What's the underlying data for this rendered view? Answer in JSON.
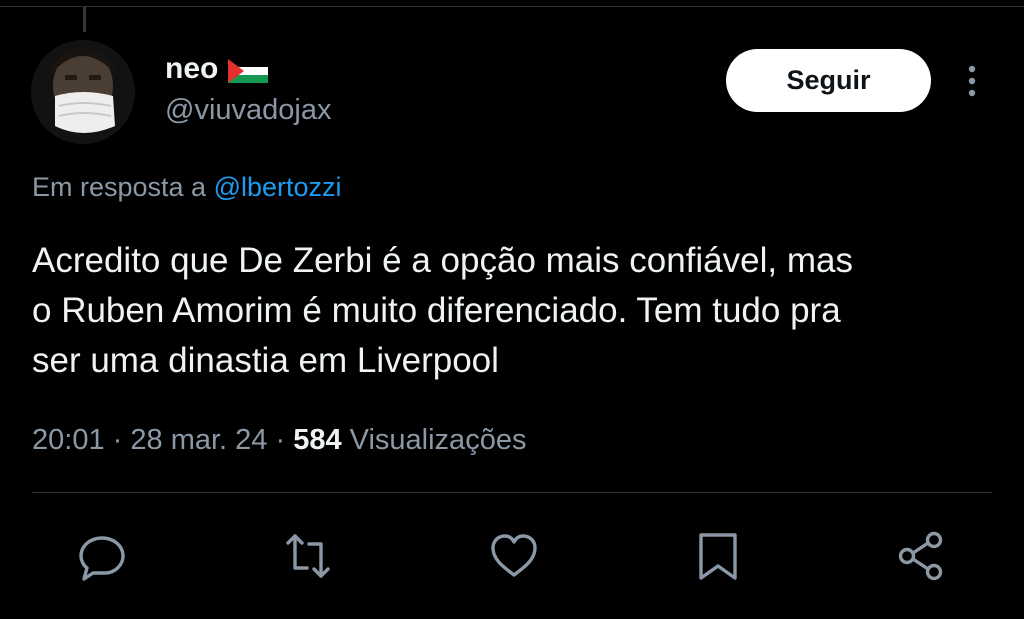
{
  "author": {
    "display_name": "neo",
    "handle": "@viuvadojax",
    "flag_icon": "palestine-flag-icon"
  },
  "follow_button": {
    "label": "Seguir"
  },
  "reply_to": {
    "prefix": "Em resposta a",
    "mention": "@lbertozzi"
  },
  "tweet": {
    "text_lines": [
      "Acredito que De Zerbi é a opção mais confiável, mas",
      "o Ruben Amorim é muito diferenciado. Tem tudo pra",
      "ser uma dinastia em Liverpool"
    ]
  },
  "meta": {
    "time": "20:01",
    "date": "28 mar. 24",
    "separator": "·",
    "views_count": "584",
    "views_label": "Visualizações"
  },
  "actions": [
    "reply-icon",
    "retweet-icon",
    "like-icon",
    "bookmark-icon",
    "share-icon"
  ],
  "colors": {
    "background": "#000000",
    "text": "#e7e9ea",
    "secondary": "#8b98a5",
    "link": "#1d9bf0",
    "button_bg": "#ffffff"
  }
}
